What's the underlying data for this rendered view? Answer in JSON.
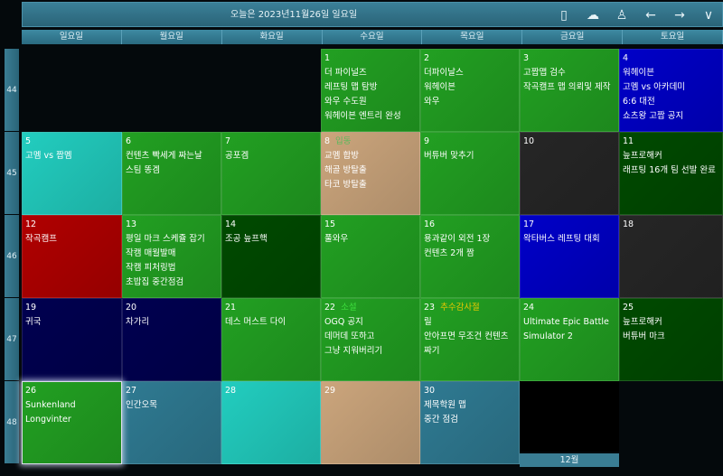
{
  "header": {
    "title": "오늘은 2023년11월26일 일요일",
    "icons": [
      {
        "name": "phone-icon",
        "glyph": "▯"
      },
      {
        "name": "cloud-check-icon",
        "glyph": "☁"
      },
      {
        "name": "user-icon",
        "glyph": "♙"
      },
      {
        "name": "arrow-left-icon",
        "glyph": "←"
      },
      {
        "name": "arrow-right-icon",
        "glyph": "→"
      },
      {
        "name": "chevron-down-icon",
        "glyph": "∨"
      }
    ]
  },
  "weekdays": [
    "일요일",
    "월요일",
    "화요일",
    "수요일",
    "목요일",
    "금요일",
    "토요일"
  ],
  "weeks": [
    "44",
    "45",
    "46",
    "47",
    "48"
  ],
  "colors": {
    "green": "#22a022",
    "cyan": "#22cdbf",
    "tan": "#cba57c",
    "gray": "#262626",
    "darkgreen": "#004a00",
    "red": "#b00000",
    "blue": "#0000c8",
    "navy": "#000050",
    "teal": "#2f7a92",
    "black": "#000000"
  },
  "cells": [
    {
      "day": "1",
      "color": "green",
      "events": [
        "더 파이널즈",
        "레프팅 맵 탐방",
        "와우 수도원",
        "워헤이븐 엔트리 완성"
      ]
    },
    {
      "day": "2",
      "color": "green",
      "events": [
        "더파이날스",
        "워헤이븐",
        "와우"
      ]
    },
    {
      "day": "3",
      "color": "green",
      "events": [
        "고짭맵 검수",
        "작곡캠프 맵 의뢰및 제작"
      ]
    },
    {
      "day": "4",
      "color": "blue",
      "events": [
        "워헤이븐",
        "고멤 vs 아카데미",
        "6:6 대전",
        "쇼츠왕 고짭 공지"
      ]
    },
    {
      "day": "5",
      "color": "cyan",
      "events": [
        "고멤 vs 짭멤"
      ]
    },
    {
      "day": "6",
      "color": "green",
      "events": [
        "컨텐츠 빡세게 짜는날",
        "스팀 똥겜"
      ]
    },
    {
      "day": "7",
      "color": "green",
      "events": [
        "공포겜"
      ]
    },
    {
      "day": "8",
      "color": "tan",
      "holiday": "입동",
      "holiday_color": "#5cb85c",
      "events": [
        "교멤 합방",
        "해골 방탈출",
        "타코 방탈출"
      ]
    },
    {
      "day": "9",
      "color": "green",
      "events": [
        "버튜버 맞추기"
      ]
    },
    {
      "day": "10",
      "color": "gray",
      "events": []
    },
    {
      "day": "11",
      "color": "darkgreen",
      "events": [
        "늪프로해커",
        "래프팅 16개 팀 선발 완료"
      ]
    },
    {
      "day": "12",
      "color": "red",
      "events": [
        "작곡캠프"
      ]
    },
    {
      "day": "13",
      "color": "green",
      "events": [
        "평일 마크 스케쥴 잡기",
        "작캠 매월발매",
        "작캠 피처링법",
        "초밥집 중간점검"
      ]
    },
    {
      "day": "14",
      "color": "darkgreen",
      "events": [
        "조공 늪프핵"
      ]
    },
    {
      "day": "15",
      "color": "green",
      "events": [
        "풀와우"
      ]
    },
    {
      "day": "16",
      "color": "green",
      "events": [
        "용과같이 외전 1장",
        "컨텐츠 2개 짬"
      ]
    },
    {
      "day": "17",
      "color": "blue",
      "events": [
        "왁타버스 레프팅 대회"
      ]
    },
    {
      "day": "18",
      "color": "gray",
      "events": []
    },
    {
      "day": "19",
      "color": "navy",
      "events": [
        "귀국"
      ]
    },
    {
      "day": "20",
      "color": "navy",
      "events": [
        "차가리"
      ]
    },
    {
      "day": "21",
      "color": "green",
      "events": [
        "데스 머스트 다이"
      ]
    },
    {
      "day": "22",
      "color": "green",
      "holiday": "소설",
      "holiday_color": "#3ee03e",
      "events": [
        "OGQ 공지",
        "데머데 또하고",
        "그냥 지워버리기"
      ]
    },
    {
      "day": "23",
      "color": "green",
      "holiday": "추수감사절",
      "holiday_color": "#e8c800",
      "events": [
        "릴",
        "안아프면 무조건 컨텐츠",
        "짜기"
      ]
    },
    {
      "day": "24",
      "color": "green",
      "events": [
        "Ultimate Epic Battle",
        "Simulator 2"
      ]
    },
    {
      "day": "25",
      "color": "darkgreen",
      "events": [
        "늪프로해커",
        "버튜버 마크"
      ]
    },
    {
      "day": "26",
      "color": "green",
      "selected": true,
      "events": [
        "Sunkenland",
        "Longvinter"
      ]
    },
    {
      "day": "27",
      "color": "teal",
      "events": [
        "인간오목"
      ]
    },
    {
      "day": "28",
      "color": "cyan",
      "events": []
    },
    {
      "day": "29",
      "color": "tan",
      "events": []
    },
    {
      "day": "30",
      "color": "teal",
      "events": [
        "제목학원 맵",
        "중간 점검"
      ]
    },
    {
      "day": "",
      "color": "black",
      "events": []
    }
  ],
  "next_month_label": "12월"
}
